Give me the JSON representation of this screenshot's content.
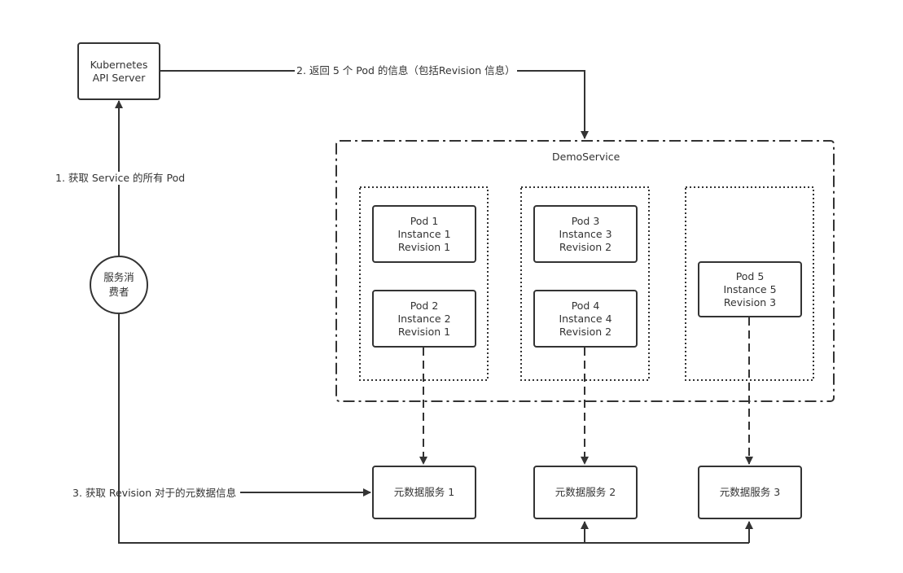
{
  "diagram": {
    "api_server": {
      "lines": [
        "Kubernetes",
        "API Server"
      ]
    },
    "consumer": {
      "lines": [
        "服务消",
        "费者"
      ]
    },
    "demo_service": {
      "title": "DemoService"
    },
    "pods": [
      {
        "lines": [
          "Pod 1",
          "Instance 1",
          "Revision 1"
        ]
      },
      {
        "lines": [
          "Pod 2",
          "Instance 2",
          "Revision 1"
        ]
      },
      {
        "lines": [
          "Pod 3",
          "Instance 3",
          "Revision 2"
        ]
      },
      {
        "lines": [
          "Pod 4",
          "Instance 4",
          "Revision 2"
        ]
      },
      {
        "lines": [
          "Pod 5",
          "Instance 5",
          "Revision 3"
        ]
      }
    ],
    "metadata_services": [
      {
        "label": "元数据服务 1"
      },
      {
        "label": "元数据服务 2"
      },
      {
        "label": "元数据服务 3"
      }
    ],
    "edges": {
      "step1": "1. 获取 Service 的所有 Pod",
      "step2": "2. 返回 5 个 Pod 的信息（包括Revision 信息）",
      "step3": "3. 获取 Revision 对于的元数据信息"
    },
    "colors": {
      "stroke": "#333333",
      "background": "#ffffff"
    }
  }
}
